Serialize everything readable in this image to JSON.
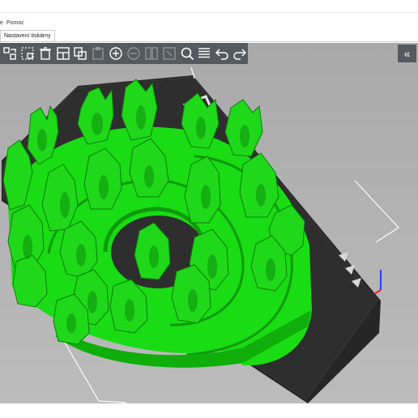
{
  "menu": {
    "partial_left": "e",
    "help_label": "Pomoc"
  },
  "tabs": [
    {
      "label": "Nastavení tiskárny"
    }
  ],
  "toolbar": {
    "buttons": [
      {
        "icon": "arrange-icon",
        "enabled": true
      },
      {
        "icon": "arrange-selection-icon",
        "enabled": true
      },
      {
        "icon": "delete-icon",
        "enabled": true
      },
      {
        "icon": "delete-all-icon",
        "enabled": true
      },
      {
        "icon": "copy-icon",
        "enabled": true
      },
      {
        "icon": "paste-icon",
        "enabled": false
      },
      {
        "icon": "add-instance-icon",
        "enabled": true
      },
      {
        "icon": "remove-instance-icon",
        "enabled": false
      },
      {
        "icon": "split-objects-icon",
        "enabled": false
      },
      {
        "icon": "split-parts-icon",
        "enabled": false
      },
      {
        "icon": "search-icon",
        "enabled": true
      },
      {
        "icon": "layers-icon",
        "enabled": true
      },
      {
        "icon": "undo-icon",
        "enabled": true
      },
      {
        "icon": "redo-icon",
        "enabled": true
      }
    ],
    "collapse_icon": "collapse-sidebar-icon"
  },
  "colors": {
    "viewport_bg": "#b0b0b0",
    "toolbar_bg": "#555a5e",
    "bed": "#2b2b2b",
    "model_green": "#22e01c",
    "model_dark_green": "#12a80e"
  }
}
